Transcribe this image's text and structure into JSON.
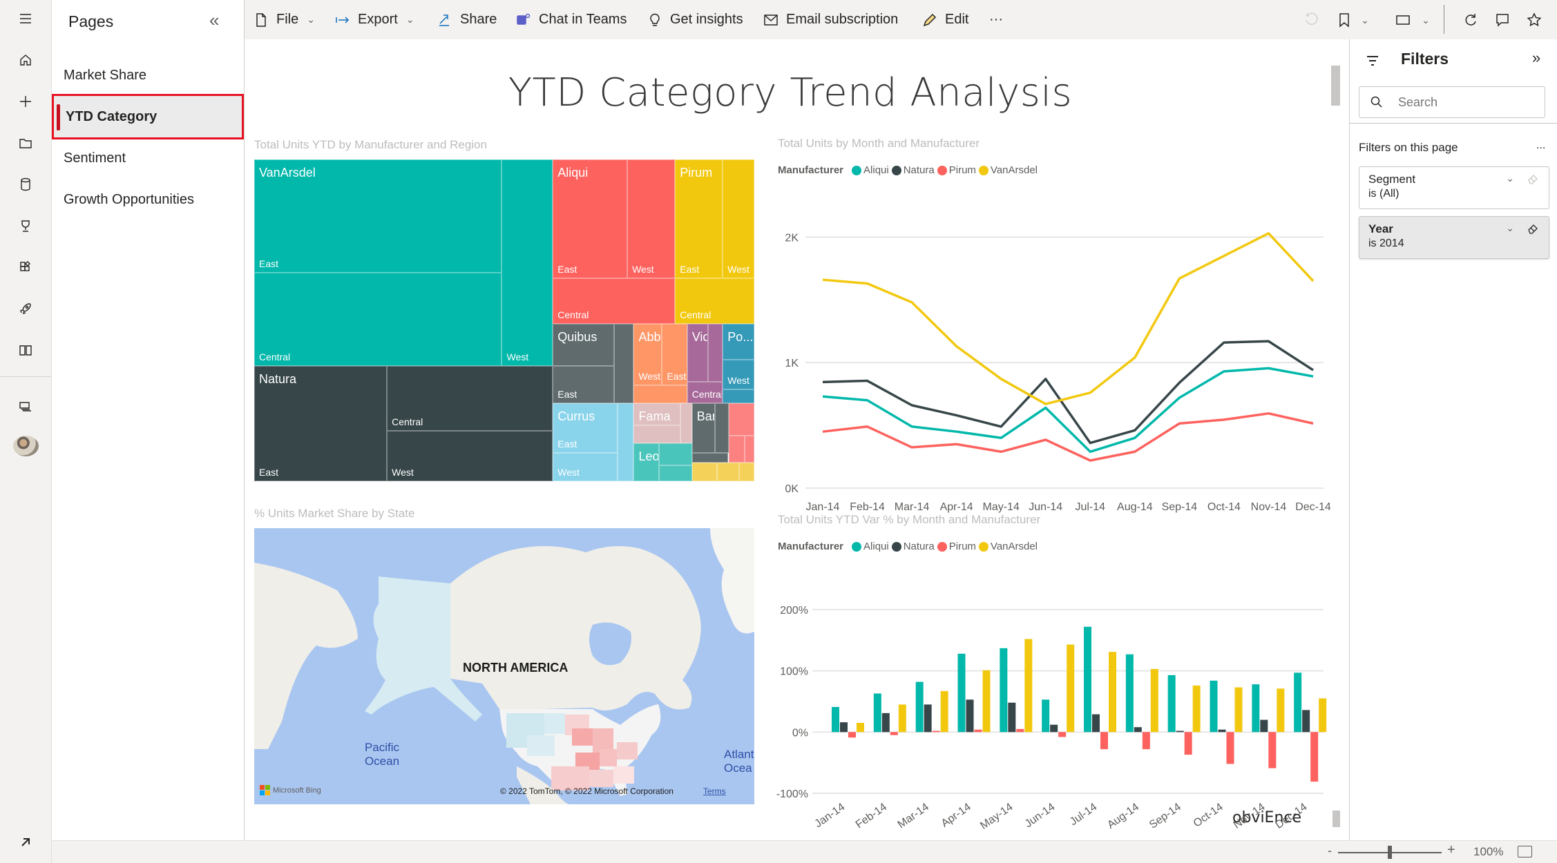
{
  "rail": {
    "items": [
      {
        "icon": "hamburger-icon"
      },
      {
        "icon": "home-icon"
      },
      {
        "icon": "create-icon"
      },
      {
        "icon": "browse-icon"
      },
      {
        "icon": "data-hub-icon"
      },
      {
        "icon": "goals-icon"
      },
      {
        "icon": "apps-icon"
      },
      {
        "icon": "deployment-icon"
      },
      {
        "icon": "learn-icon"
      },
      {
        "icon": "workspaces-icon"
      }
    ],
    "avatar": "user-avatar",
    "expand_icon": "arrow-up-right-icon"
  },
  "pages": {
    "title": "Pages",
    "collapse_glyph": "«",
    "items": [
      {
        "label": "Market Share",
        "active": false
      },
      {
        "label": "YTD Category",
        "active": true
      },
      {
        "label": "Sentiment",
        "active": false
      },
      {
        "label": "Growth Opportunities",
        "active": false
      }
    ]
  },
  "toolbar": {
    "file": "File",
    "export": "Export",
    "share": "Share",
    "chat_in_teams": "Chat in Teams",
    "get_insights": "Get insights",
    "email_subscription": "Email subscription",
    "edit": "Edit",
    "more": "···"
  },
  "report": {
    "title": "YTD Category Trend Analysis",
    "brand": "obviEnce"
  },
  "colors": {
    "teal": "#01B8AA",
    "dark": "#374649",
    "red": "#FD625E",
    "yellow": "#F2C80F",
    "gray": "#5F6B6D",
    "lightblue": "#8AD4EB",
    "orange": "#FE9666",
    "purple": "#A66999",
    "blue": "#3599B8",
    "pink": "#DFBFBF",
    "aqua": "#4AC5BB",
    "salmon": "#FB8281",
    "lightyellow": "#F4D25A"
  },
  "treemap": {
    "title": "Total Units YTD by Manufacturer and Region",
    "manufacturers": [
      {
        "name": "VanArsdel",
        "regions": [
          "East",
          "Central",
          "West"
        ]
      },
      {
        "name": "Natura",
        "regions": [
          "East",
          "Central",
          "West"
        ]
      },
      {
        "name": "Aliqui",
        "regions": [
          "East",
          "West",
          "Central"
        ]
      },
      {
        "name": "Pirum",
        "regions": [
          "East",
          "West",
          "Central"
        ]
      },
      {
        "name": "Quibus",
        "regions": [
          "East"
        ]
      },
      {
        "name": "Abbas",
        "regions": [
          "West",
          "East"
        ]
      },
      {
        "name": "Vict...",
        "regions": [
          "Central"
        ]
      },
      {
        "name": "Po...",
        "regions": [
          "West"
        ]
      },
      {
        "name": "Currus",
        "regions": [
          "East",
          "West"
        ]
      },
      {
        "name": "Fama",
        "regions": []
      },
      {
        "name": "Barba",
        "regions": []
      },
      {
        "name": "Leo",
        "regions": []
      }
    ]
  },
  "map": {
    "title": "% Units Market Share by State",
    "labels": {
      "continent": "NORTH AMERICA",
      "pacific": "Pacific Ocean",
      "atlantic": "Atlant Ocea"
    },
    "bing": "Microsoft Bing",
    "copyright": "© 2022 TomTom, © 2022 Microsoft Corporation",
    "terms": "Terms"
  },
  "chart_data": [
    {
      "type": "line",
      "title": "Total Units by Month and Manufacturer",
      "legend_title": "Manufacturer",
      "legend_position": "top-left",
      "categories": [
        "Jan-14",
        "Feb-14",
        "Mar-14",
        "Apr-14",
        "May-14",
        "Jun-14",
        "Jul-14",
        "Aug-14",
        "Sep-14",
        "Oct-14",
        "Nov-14",
        "Dec-14"
      ],
      "y_ticks": [
        "0K",
        "1K",
        "2K"
      ],
      "ylim": [
        0,
        2200
      ],
      "grid": true,
      "series": [
        {
          "name": "Aliqui",
          "color": "#01B8AA",
          "values": [
            730,
            700,
            490,
            450,
            400,
            640,
            290,
            400,
            720,
            930,
            955,
            890
          ]
        },
        {
          "name": "Natura",
          "color": "#374649",
          "values": [
            845,
            855,
            660,
            580,
            490,
            870,
            360,
            460,
            840,
            1160,
            1170,
            940
          ]
        },
        {
          "name": "Pirum",
          "color": "#FD625E",
          "values": [
            450,
            490,
            325,
            350,
            290,
            385,
            220,
            290,
            515,
            545,
            595,
            515
          ]
        },
        {
          "name": "VanArsdel",
          "color": "#F2C80F",
          "values": [
            1660,
            1630,
            1480,
            1130,
            870,
            670,
            760,
            1040,
            1670,
            1850,
            2030,
            1650
          ]
        }
      ]
    },
    {
      "type": "bar",
      "title": "Total Units YTD Var % by Month and Manufacturer",
      "legend_title": "Manufacturer",
      "legend_position": "top-left",
      "categories": [
        "Jan-14",
        "Feb-14",
        "Mar-14",
        "Apr-14",
        "May-14",
        "Jun-14",
        "Jul-14",
        "Aug-14",
        "Sep-14",
        "Oct-14",
        "Nov-14",
        "Dec-14"
      ],
      "y_ticks": [
        "-100%",
        "0%",
        "100%",
        "200%"
      ],
      "ylim": [
        -100,
        200
      ],
      "grid": true,
      "series": [
        {
          "name": "Aliqui",
          "color": "#01B8AA",
          "values": [
            41,
            63,
            82,
            128,
            137,
            53,
            172,
            127,
            93,
            84,
            78,
            97
          ]
        },
        {
          "name": "Natura",
          "color": "#374649",
          "values": [
            16,
            31,
            45,
            53,
            48,
            12,
            29,
            8,
            2,
            4,
            20,
            36
          ]
        },
        {
          "name": "Pirum",
          "color": "#FD625E",
          "values": [
            -9,
            -5,
            2,
            4,
            5,
            -8,
            -28,
            -28,
            -37,
            -52,
            -59,
            -81
          ]
        },
        {
          "name": "VanArsdel",
          "color": "#F2C80F",
          "values": [
            15,
            45,
            67,
            101,
            152,
            143,
            131,
            103,
            76,
            73,
            71,
            55
          ]
        }
      ]
    }
  ],
  "filters": {
    "title": "Filters",
    "expand_glyph": "»",
    "search_placeholder": "Search",
    "section_label": "Filters on this page",
    "more": "...",
    "cards": [
      {
        "field": "Segment",
        "value": "is (All)",
        "active": false
      },
      {
        "field": "Year",
        "value": "is 2014",
        "active": true
      }
    ]
  },
  "status": {
    "zoom_level": "100%",
    "zoom_fraction": 0.5,
    "minus": "-",
    "plus": "+"
  }
}
